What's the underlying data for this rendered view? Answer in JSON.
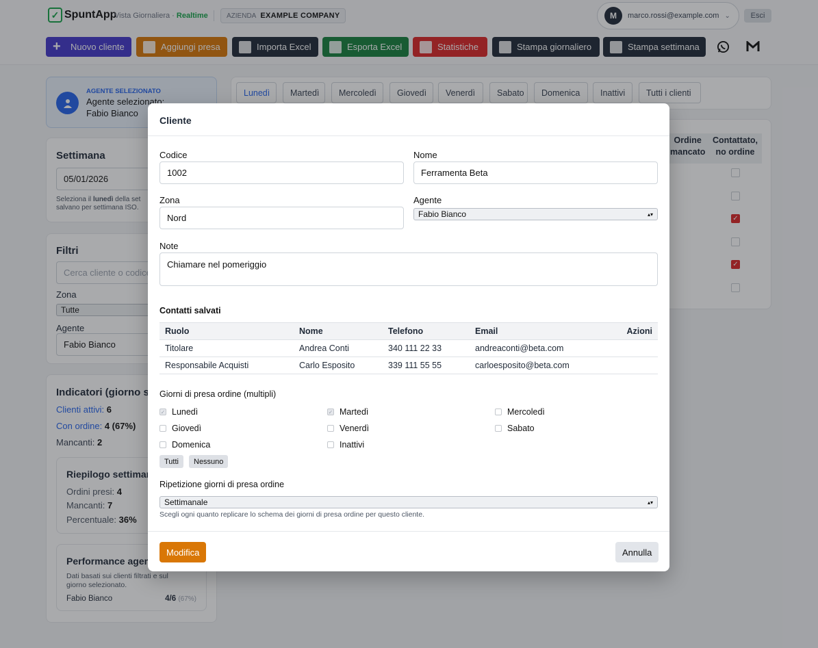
{
  "header": {
    "app_name": "SpuntApp",
    "view_label": "Vista Giornaliera ·",
    "realtime_label": "Realtime",
    "company_label": "AZIENDA",
    "company_name": "EXAMPLE COMPANY",
    "user_initial": "M",
    "user_email": "marco.rossi@example.com",
    "logout_label": "Esci"
  },
  "toolbar": [
    {
      "label": "Nuovo cliente",
      "color": "#4338ca",
      "icon": "plus-icon"
    },
    {
      "label": "Aggiungi presa",
      "color": "#d97706",
      "icon": "memo-icon"
    },
    {
      "label": "Importa Excel",
      "color": "#1f2937",
      "icon": "inbox-tray-icon"
    },
    {
      "label": "Esporta Excel",
      "color": "#15803d",
      "icon": "outbox-tray-icon"
    },
    {
      "label": "Statistiche",
      "color": "#dc2626",
      "icon": "bar-chart-icon"
    },
    {
      "label": "Stampa giornaliero",
      "color": "#1f2937",
      "icon": "printer-icon"
    },
    {
      "label": "Stampa settimana",
      "color": "#1f2937",
      "icon": "calendar-icon"
    }
  ],
  "sidebar": {
    "agent_caption": "AGENTE SELEZIONATO",
    "agent_title": "Agente selezionato:",
    "agent_name": "Fabio Bianco",
    "week_title": "Settimana",
    "week_value": "05/01/2026",
    "week_help_1": "Seleziona il",
    "week_help_bold": "lunedì",
    "week_help_2": "della set",
    "week_help_3": "salvano per settimana ISO.",
    "filters_title": "Filtri",
    "search_placeholder": "Cerca cliente o codice",
    "zone_label": "Zona",
    "zone_value": "Tutte",
    "agent_label": "Agente",
    "agent_value": "Fabio Bianco",
    "kpi_title": "Indicatori (giorno sel",
    "kpi_active_label": "Clienti attivi:",
    "kpi_active_value": "6",
    "kpi_order_label": "Con ordine:",
    "kpi_order_value": "4 (67%)",
    "kpi_missing_label": "Mancanti:",
    "kpi_missing_value": "2",
    "summary_title": "Riepilogo settiman",
    "summary_orders_label": "Ordini presi:",
    "summary_orders_value": "4",
    "summary_missing_label": "Mancanti:",
    "summary_missing_value": "7",
    "summary_pct_label": "Percentuale:",
    "summary_pct_value": "36%",
    "perf_title": "Performance agen",
    "perf_help": "Dati basati sui clienti filtrati e sul giorno selezionato.",
    "perf_agent": "Fabio Bianco",
    "perf_value": "4/6",
    "perf_pct": "(67%)"
  },
  "day_tabs": [
    "Lunedì",
    "Martedì",
    "Mercoledì",
    "Giovedì",
    "Venerdì",
    "Sabato",
    "Domenica",
    "Inattivi",
    "Tutti i clienti"
  ],
  "bg_table": {
    "col_missing_1": "Ordine",
    "col_missing_2": "mancato",
    "col_contacted_1": "Contattato,",
    "col_contacted_2": "no ordine",
    "contacted_checks": [
      false,
      false,
      true,
      false,
      true,
      false
    ]
  },
  "modal": {
    "title": "Cliente",
    "code_label": "Codice",
    "code_value": "1002",
    "name_label": "Nome",
    "name_value": "Ferramenta Beta",
    "zone_label": "Zona",
    "zone_value": "Nord",
    "agent_label": "Agente",
    "agent_value": "Fabio Bianco",
    "notes_label": "Note",
    "notes_value": "Chiamare nel pomeriggio",
    "contacts_title": "Contatti salvati",
    "contacts_headers": [
      "Ruolo",
      "Nome",
      "Telefono",
      "Email",
      "Azioni"
    ],
    "contacts": [
      {
        "role": "Titolare",
        "name": "Andrea Conti",
        "phone": "340 111 22 33",
        "email": "andreaconti@beta.com"
      },
      {
        "role": "Responsabile Acquisti",
        "name": "Carlo Esposito",
        "phone": "339 111 55 55",
        "email": "carloesposito@beta.com"
      }
    ],
    "days_title": "Giorni di presa ordine (multipli)",
    "days": [
      {
        "label": "Lunedì",
        "checked": true
      },
      {
        "label": "Martedì",
        "checked": true
      },
      {
        "label": "Mercoledì",
        "checked": false
      },
      {
        "label": "Giovedì",
        "checked": false
      },
      {
        "label": "Venerdì",
        "checked": false
      },
      {
        "label": "Sabato",
        "checked": false
      },
      {
        "label": "Domenica",
        "checked": false
      },
      {
        "label": "Inattivi",
        "checked": false
      }
    ],
    "all_label": "Tutti",
    "none_label": "Nessuno",
    "repeat_label": "Ripetizione giorni di presa ordine",
    "repeat_value": "Settimanale",
    "repeat_help": "Scegli ogni quanto replicare lo schema dei giorni di presa ordine per questo cliente.",
    "save_label": "Modifica",
    "cancel_label": "Annulla"
  }
}
